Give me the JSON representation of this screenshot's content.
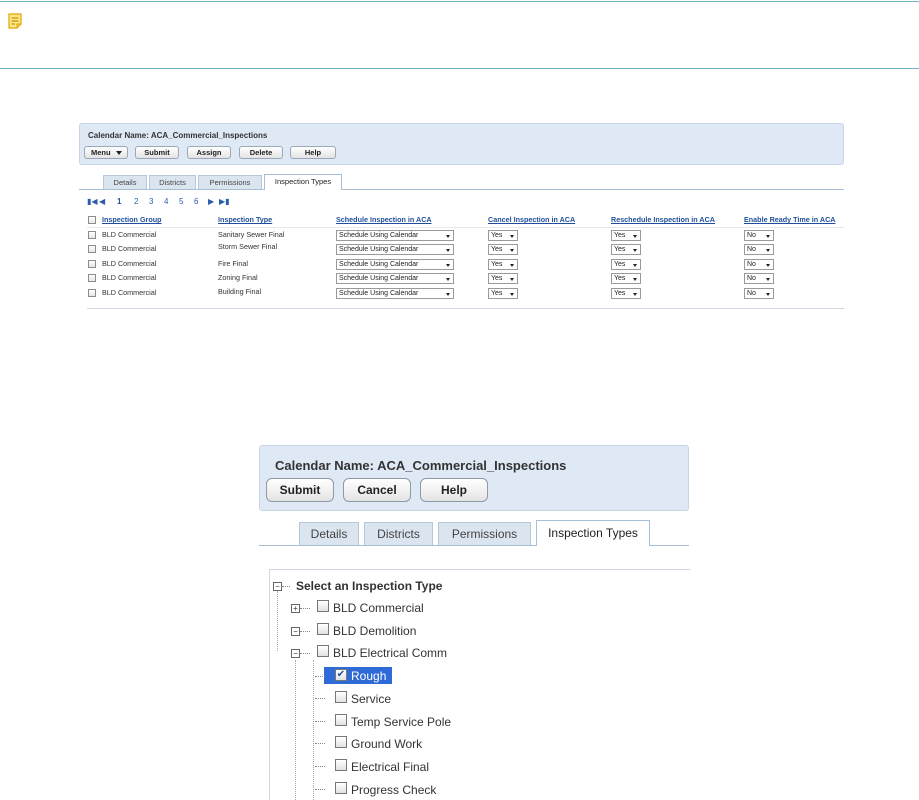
{
  "note": {
    "icon": "note-icon"
  },
  "screen1": {
    "calendar_label": "Calendar Name: ACA_Commercial_Inspections",
    "buttons": [
      "Menu",
      "Submit",
      "Assign",
      "Delete",
      "Help"
    ],
    "tabs": [
      "Details",
      "Districts",
      "Permissions",
      "Inspection Types"
    ],
    "active_tab": "Inspection Types",
    "pages": [
      "1",
      "2",
      "3",
      "4",
      "5",
      "6"
    ],
    "columns": [
      "Inspection Group",
      "Inspection Type",
      "Schedule Inspection in ACA",
      "Cancel Inspection in ACA",
      "Reschedule Inspection in ACA",
      "Enable Ready Time in ACA"
    ],
    "rows": [
      {
        "group": "BLD Commercial",
        "type": "Sanitary Sewer Final",
        "schedule": "Schedule Using Calendar",
        "cancel": "Yes",
        "reschedule": "Yes",
        "ready": "No"
      },
      {
        "group": "BLD Commercial",
        "type": "Storm Sewer Final",
        "schedule": "Schedule Using Calendar",
        "cancel": "Yes",
        "reschedule": "Yes",
        "ready": "No"
      },
      {
        "group": "BLD Commercial",
        "type": "Fire Final",
        "schedule": "Schedule Using Calendar",
        "cancel": "Yes",
        "reschedule": "Yes",
        "ready": "No"
      },
      {
        "group": "BLD Commercial",
        "type": "Zoning Final",
        "schedule": "Schedule Using Calendar",
        "cancel": "Yes",
        "reschedule": "Yes",
        "ready": "No"
      },
      {
        "group": "BLD Commercial",
        "type": "Building Final",
        "schedule": "Schedule Using Calendar",
        "cancel": "Yes",
        "reschedule": "Yes",
        "ready": "No"
      }
    ]
  },
  "screen2": {
    "calendar_label": "Calendar Name: ACA_Commercial_Inspections",
    "buttons": [
      "Submit",
      "Cancel",
      "Help"
    ],
    "tabs": [
      "Details",
      "Districts",
      "Permissions",
      "Inspection Types"
    ],
    "active_tab": "Inspection Types",
    "tree": {
      "root": "Select an Inspection Type",
      "groups": [
        {
          "label": "BLD Commercial",
          "expanded": false,
          "checked": false
        },
        {
          "label": "BLD Demolition",
          "expanded": true,
          "checked": false
        },
        {
          "label": "BLD Electrical Comm",
          "expanded": true,
          "checked": false
        }
      ],
      "children": [
        {
          "label": "Rough",
          "checked": true,
          "selected": true
        },
        {
          "label": "Service",
          "checked": false,
          "selected": false
        },
        {
          "label": "Temp Service Pole",
          "checked": false,
          "selected": false
        },
        {
          "label": "Ground Work",
          "checked": false,
          "selected": false
        },
        {
          "label": "Electrical Final",
          "checked": false,
          "selected": false
        },
        {
          "label": "Progress Check",
          "checked": false,
          "selected": false
        }
      ]
    }
  }
}
